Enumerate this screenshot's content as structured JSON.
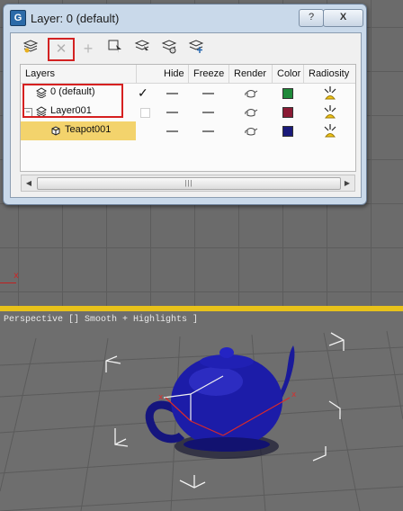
{
  "dialog": {
    "title": "Layer: 0 (default)",
    "help_label": "?",
    "close_label": "X",
    "app_icon_letter": "G"
  },
  "toolbar": {
    "buttons": [
      {
        "name": "create-layer",
        "icon": "layers-new-icon"
      },
      {
        "name": "delete-layer",
        "icon": "close-icon",
        "label": "✕"
      },
      {
        "name": "add-to-layer",
        "icon": "plus-icon",
        "label": "+"
      },
      {
        "name": "select-objects",
        "icon": "select-icon"
      },
      {
        "name": "highlight-layer",
        "icon": "highlight-icon"
      },
      {
        "name": "hide-all",
        "icon": "hide-icon"
      },
      {
        "name": "freeze-all",
        "icon": "freeze-icon"
      }
    ]
  },
  "table": {
    "columns": [
      "Layers",
      "Hide",
      "Freeze",
      "Render",
      "Color",
      "Radiosity"
    ],
    "rows": [
      {
        "name": "0 (default)",
        "active": true,
        "color": "#1f8a3a",
        "selected": false
      },
      {
        "name": "Layer001",
        "active": false,
        "color": "#8a1a34",
        "selected": false,
        "expanded": true
      },
      {
        "name": "Teapot001",
        "active": false,
        "color": "#1a1a7a",
        "selected": true
      }
    ],
    "active_mark": "✓",
    "expander_mark": "−"
  },
  "scrollbar": {
    "left_arrow": "◀",
    "right_arrow": "▶",
    "grip": "|||"
  },
  "viewports": {
    "top_axis_label": "x",
    "perspective_label": "Perspective [] Smooth + Highlights ]",
    "perspective_axis_label": "x"
  },
  "colors": {
    "dialog_bg": "#c9d9ea",
    "selection": "#f3d36c",
    "highlight_red": "#d32222",
    "viewport_active": "#e8c21a",
    "teapot": "#1c1ca8"
  }
}
